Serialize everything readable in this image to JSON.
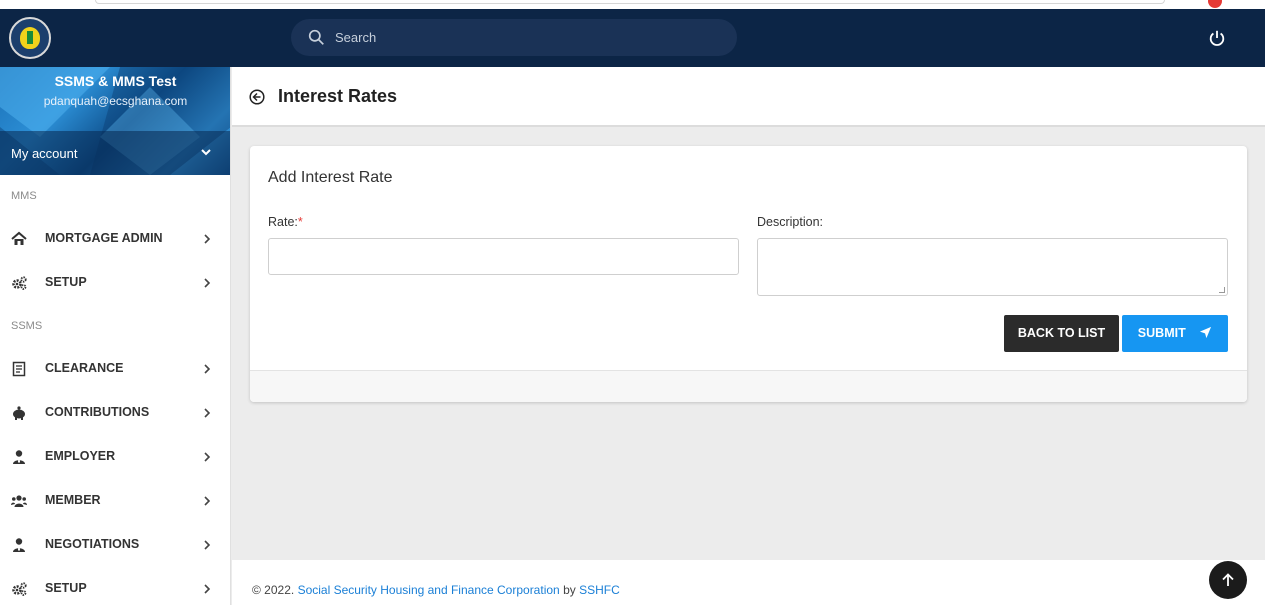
{
  "navbar": {
    "search_placeholder": "Search"
  },
  "user": {
    "name": "SSMS & MMS Test",
    "email": "pdanquah@ecsghana.com",
    "account_label": "My account"
  },
  "sidebar": {
    "mms_title": "MMS",
    "mms_items": [
      {
        "label": "MORTGAGE ADMIN",
        "icon": "home-icon"
      },
      {
        "label": "SETUP",
        "icon": "gears-icon"
      }
    ],
    "ssms_title": "SSMS",
    "ssms_items": [
      {
        "label": "CLEARANCE",
        "icon": "document-icon"
      },
      {
        "label": "CONTRIBUTIONS",
        "icon": "piggy-bank-icon"
      },
      {
        "label": "EMPLOYER",
        "icon": "user-tie-icon"
      },
      {
        "label": "MEMBER",
        "icon": "users-icon"
      },
      {
        "label": "NEGOTIATIONS",
        "icon": "user-tie-icon"
      },
      {
        "label": "SETUP",
        "icon": "gears-icon"
      }
    ]
  },
  "page": {
    "title": "Interest Rates"
  },
  "form": {
    "heading": "Add Interest Rate",
    "rate_label": "Rate:",
    "rate_required": "*",
    "rate_value": "",
    "description_label": "Description:",
    "description_value": "",
    "back_button": "BACK TO LIST",
    "submit_button": "SUBMIT"
  },
  "footer": {
    "copyright": "© 2022.",
    "org_link": "Social Security Housing and Finance Corporation",
    "by": "by",
    "brand_link": "SSHFC"
  },
  "colors": {
    "navbar": "#0c2546",
    "accent": "#1696f2",
    "dark_button": "#2b2b2b",
    "required": "#e53935"
  }
}
